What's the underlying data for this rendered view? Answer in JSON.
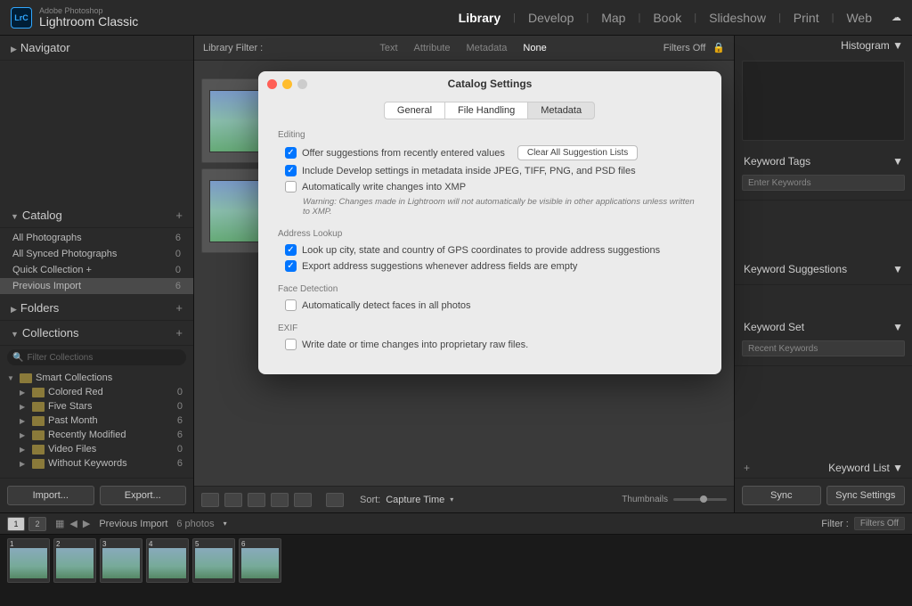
{
  "app": {
    "logo_initials": "LrC",
    "logo_sub": "Adobe Photoshop",
    "logo_main": "Lightroom Classic"
  },
  "modules": [
    {
      "label": "Library",
      "active": true
    },
    {
      "label": "Develop",
      "active": false
    },
    {
      "label": "Map",
      "active": false
    },
    {
      "label": "Book",
      "active": false
    },
    {
      "label": "Slideshow",
      "active": false
    },
    {
      "label": "Print",
      "active": false
    },
    {
      "label": "Web",
      "active": false
    }
  ],
  "left": {
    "navigator": "Navigator",
    "catalog": {
      "title": "Catalog",
      "items": [
        {
          "label": "All Photographs",
          "count": "6"
        },
        {
          "label": "All Synced Photographs",
          "count": "0"
        },
        {
          "label": "Quick Collection  +",
          "count": "0"
        },
        {
          "label": "Previous Import",
          "count": "6",
          "sel": true
        }
      ]
    },
    "folders": {
      "title": "Folders"
    },
    "collections": {
      "title": "Collections",
      "search_ph": "Filter Collections",
      "smart": "Smart Collections",
      "items": [
        {
          "label": "Colored Red",
          "count": "0"
        },
        {
          "label": "Five Stars",
          "count": "0"
        },
        {
          "label": "Past Month",
          "count": "6"
        },
        {
          "label": "Recently Modified",
          "count": "6"
        },
        {
          "label": "Video Files",
          "count": "0"
        },
        {
          "label": "Without Keywords",
          "count": "6"
        }
      ]
    },
    "import": "Import...",
    "export": "Export..."
  },
  "filter": {
    "label": "Library Filter :",
    "tabs": [
      "Text",
      "Attribute",
      "Metadata",
      "None"
    ],
    "active": "None",
    "filters_off": "Filters Off"
  },
  "toolbar": {
    "sort_label": "Sort:",
    "sort_value": "Capture Time",
    "thumbs": "Thumbnails"
  },
  "right": {
    "histogram": "Histogram",
    "kw_tags": "Keyword Tags",
    "kw_tags_ph": "Enter Keywords",
    "kw_sugg": "Keyword Suggestions",
    "kw_set": "Keyword Set",
    "kw_set_val": "Recent Keywords",
    "kw_list": "Keyword List",
    "sync": "Sync",
    "sync_settings": "Sync Settings"
  },
  "film": {
    "source": "Previous Import",
    "count": "6 photos",
    "filter_label": "Filter :",
    "filter_val": "Filters Off",
    "thumbs": [
      1,
      2,
      3,
      4,
      5,
      6
    ]
  },
  "dialog": {
    "title": "Catalog Settings",
    "tabs": [
      "General",
      "File Handling",
      "Metadata"
    ],
    "active_tab": "Metadata",
    "sections": {
      "editing": {
        "title": "Editing",
        "opt1": "Offer suggestions from recently entered values",
        "opt1_on": true,
        "btn1": "Clear All Suggestion Lists",
        "opt2": "Include Develop settings in metadata inside JPEG, TIFF, PNG, and PSD files",
        "opt2_on": true,
        "opt3": "Automatically write changes into XMP",
        "opt3_on": false,
        "warn": "Warning: Changes made in Lightroom will not automatically be visible in other applications unless written to XMP."
      },
      "address": {
        "title": "Address Lookup",
        "opt1": "Look up city, state and country of GPS coordinates to provide address suggestions",
        "opt1_on": true,
        "opt2": "Export address suggestions whenever address fields are empty",
        "opt2_on": true
      },
      "face": {
        "title": "Face Detection",
        "opt1": "Automatically detect faces in all photos",
        "opt1_on": false
      },
      "exif": {
        "title": "EXIF",
        "opt1": "Write date or time changes into proprietary raw files.",
        "opt1_on": false
      }
    }
  }
}
